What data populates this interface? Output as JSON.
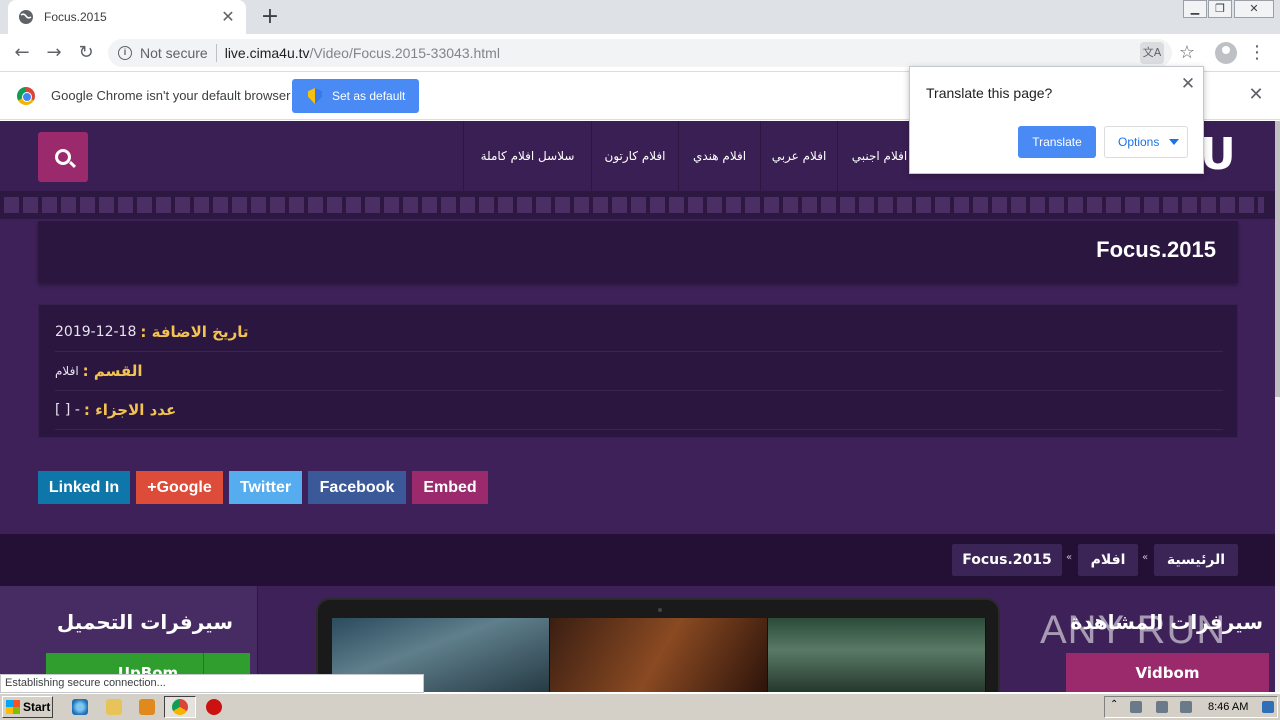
{
  "browser": {
    "tab_title": "Focus.2015",
    "new_tab_symbol": "+",
    "url_security": "Not secure",
    "url_host": "live.cima4u.tv",
    "url_path": "/Video/Focus.2015-33043.html"
  },
  "infobar": {
    "message": "Google Chrome isn't your default browser",
    "button": "Set as default"
  },
  "translate_bubble": {
    "title": "Translate this page?",
    "translate_button": "Translate",
    "options_button": "Options"
  },
  "site": {
    "nav_items": [
      "سلاسل افلام كاملة",
      "افلام كارتون",
      "افلام هندي",
      "افلام عربي",
      "افلام اجنبي"
    ],
    "logo_letter": "U",
    "page_title": "Focus.2015",
    "info": {
      "date_label": "تاريخ الاضافة :",
      "date_value": "2019-12-18",
      "category_label": "القسم :",
      "category_value": "افلام",
      "parts_label": "عدد الاجزاء :",
      "parts_value": "[ ] -"
    },
    "share_buttons": [
      "Linked In",
      "+Google",
      "Twitter",
      "Facebook",
      "Embed"
    ],
    "breadcrumb": [
      "الرئيسية",
      "افلام",
      "Focus.2015"
    ],
    "breadcrumb_sep": "«",
    "download_servers_title": "سيرفرات التحميل",
    "download_server": "UpBom",
    "watch_servers_title": "سيرفرات المشاهدة",
    "watch_server": "Vidbom",
    "watermark": "ANY RUN"
  },
  "status_text": "Establishing secure connection...",
  "taskbar": {
    "start_label": "Start",
    "clock": "8:46 AM"
  },
  "colors": {
    "site_bg": "#3d2158",
    "accent_magenta": "#9a2a6c",
    "label_gold": "#f3c350",
    "chrome_blue": "#4a8af4"
  }
}
